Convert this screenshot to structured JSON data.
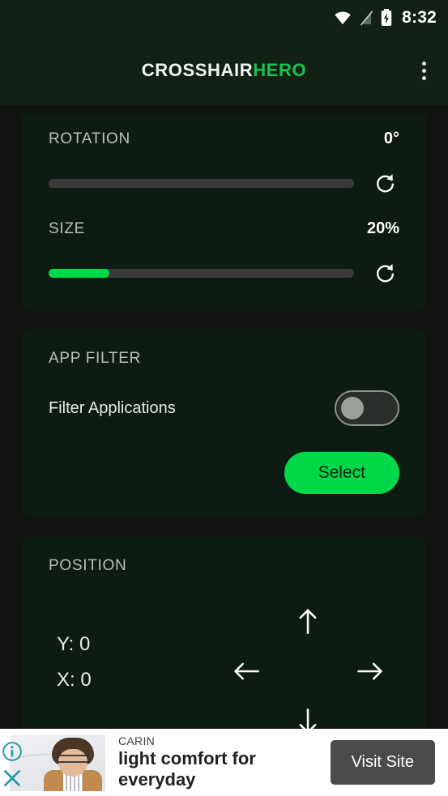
{
  "status_bar": {
    "time": "8:32",
    "icons": [
      "wifi-icon",
      "no-signal-icon",
      "battery-charging-icon"
    ]
  },
  "app_bar": {
    "title_part1": "CROSSHAIR",
    "title_part2": "HERO",
    "overflow_menu": "overflow-menu-icon",
    "accent_color": "#18c24f",
    "background_color": "#122015"
  },
  "sections": {
    "rotation": {
      "label": "ROTATION",
      "value": "0°",
      "slider_percent": 0,
      "reset_icon": "refresh-icon"
    },
    "size": {
      "label": "SIZE",
      "value": "20%",
      "slider_percent": 20,
      "reset_icon": "refresh-icon"
    },
    "app_filter": {
      "label": "APP FILTER",
      "toggle_label": "Filter Applications",
      "toggle_state": "off",
      "select_label": "Select"
    },
    "position": {
      "label": "POSITION",
      "y_label": "Y: 0",
      "x_label": "X: 0",
      "arrows": [
        "arrow-up-icon",
        "arrow-left-icon",
        "arrow-right-icon",
        "arrow-down-icon"
      ]
    }
  },
  "ad": {
    "brand": "CARIN",
    "headline": "light comfort for everyday",
    "cta": "Visit Site",
    "info_icon": "ad-info-icon",
    "close_icon": "ad-close-icon"
  },
  "colors": {
    "accent_green": "#00d84a",
    "card_background": "#0e1b12",
    "page_background": "#111311"
  }
}
